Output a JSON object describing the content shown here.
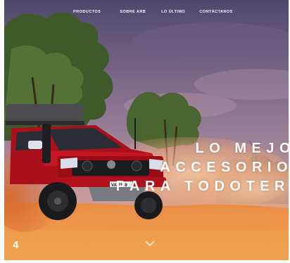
{
  "nav": {
    "items": [
      {
        "label": "PRODUCTOS"
      },
      {
        "label": "SOBRE ARB"
      },
      {
        "label": "LO ÚLTIMO"
      },
      {
        "label": "CONTÁCTANOS"
      }
    ]
  },
  "hero": {
    "lines": [
      "LO MEJO",
      "ACCESORIO",
      "PARA TODOTER"
    ]
  },
  "slide": {
    "number": "4"
  },
  "icons": {
    "scroll": "chevron-down-icon"
  },
  "colors": {
    "sky_top": "#5a4f75",
    "sky_mid": "#9a7f96",
    "dust": "#e07a3a",
    "sand": "#f09a46",
    "truck_red": "#b3121e",
    "text": "#ffffff"
  },
  "vehicle": {
    "plate": "VA 3199"
  }
}
